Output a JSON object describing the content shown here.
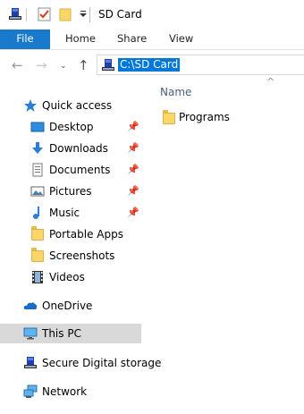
{
  "window": {
    "title": "SD Card"
  },
  "ribbon": {
    "tabs": [
      {
        "label": "File"
      },
      {
        "label": "Home"
      },
      {
        "label": "Share"
      },
      {
        "label": "View"
      }
    ]
  },
  "address": {
    "path": "C:\\SD Card"
  },
  "nav": {
    "quick_access": "Quick access",
    "items": [
      {
        "label": "Desktop",
        "icon": "desktop-icon",
        "pinned": true
      },
      {
        "label": "Downloads",
        "icon": "downloads-icon",
        "pinned": true
      },
      {
        "label": "Documents",
        "icon": "documents-icon",
        "pinned": true
      },
      {
        "label": "Pictures",
        "icon": "pictures-icon",
        "pinned": true
      },
      {
        "label": "Music",
        "icon": "music-icon",
        "pinned": true
      },
      {
        "label": "Portable Apps",
        "icon": "folder-icon",
        "pinned": false
      },
      {
        "label": "Screenshots",
        "icon": "folder-icon",
        "pinned": false
      },
      {
        "label": "Videos",
        "icon": "videos-icon",
        "pinned": false
      }
    ],
    "onedrive": "OneDrive",
    "this_pc": "This PC",
    "secure_digital": "Secure Digital storage",
    "network": "Network"
  },
  "content": {
    "column_name": "Name",
    "items": [
      {
        "label": "Programs",
        "icon": "folder-icon"
      }
    ]
  },
  "colors": {
    "accent": "#1979ca",
    "selection": "#0078d7",
    "nav_selected": "#d9d9d9"
  }
}
